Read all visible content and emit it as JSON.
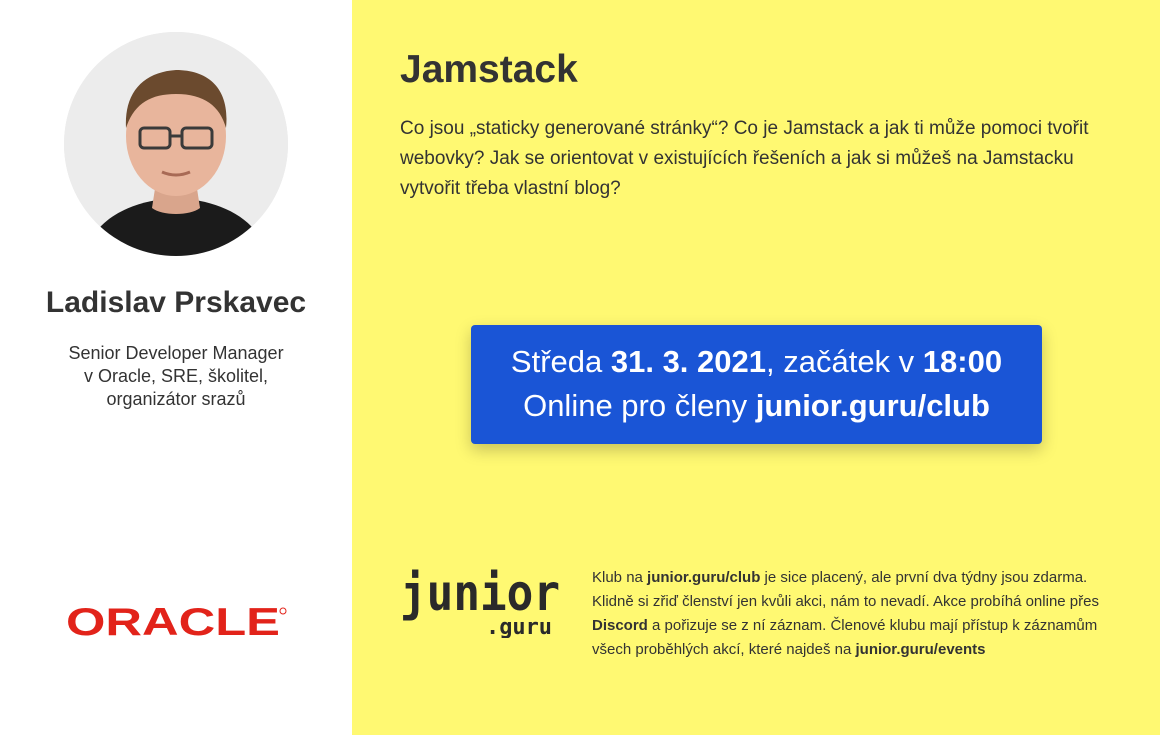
{
  "speaker": {
    "name": "Ladislav Prskavec",
    "role_line1": "Senior Developer Manager",
    "role_line2": "v Oracle, SRE, školitel,",
    "role_line3": "organizátor srazů",
    "photo": "speaker-photo",
    "company_logo": {
      "text": "ORACLE",
      "color": "#e2231a"
    }
  },
  "talk": {
    "title": "Jamstack",
    "description": "Co jsou „staticky generované stránky“? Co je Jamstack a jak ti může pomoci tvořit webovky? Jak se orientovat v existujících řešeních a jak si můžeš na Jamstacku vytvořit třeba vlastní blog?"
  },
  "event": {
    "day": "Středa ",
    "date": "31. 3. 2021",
    "start_text": ", začátek v ",
    "time": "18:00",
    "online_text": "Online pro členy ",
    "club_url": "junior.guru/club"
  },
  "club": {
    "logo_main": "junior",
    "logo_sub": ".guru",
    "p1": "Klub na ",
    "p1_bold": "junior.guru/club",
    "p2": " je sice placený, ale první dva týdny jsou zdarma. Klidně si zřiď členství jen kvůli akci, nám to nevadí. Akce probíhá online přes ",
    "p2_bold": "Discord",
    "p3": " a pořizuje se z ní záznam. Členové klubu mají přístup k záznamům všech proběhlých akcí, které najdeš na ",
    "p3_bold": "junior.guru/events"
  },
  "colors": {
    "yellow_bg": "#fff972",
    "event_blue": "#1a55d6",
    "oracle_red": "#e2231a"
  }
}
